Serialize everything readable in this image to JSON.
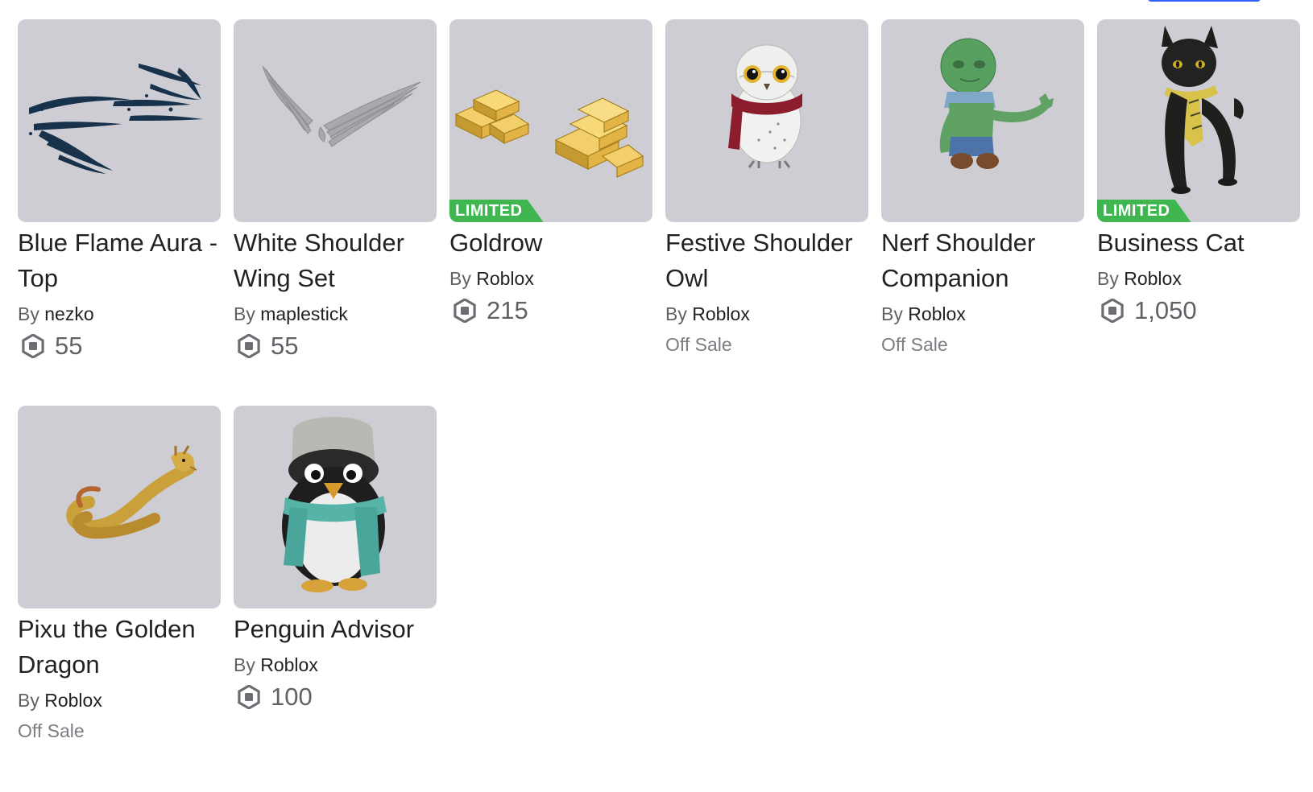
{
  "items": [
    {
      "name": "Blue Flame Aura - Top",
      "by": "By",
      "creator": "nezko",
      "price": "55",
      "limited": false,
      "limited_label": "",
      "off_sale_label": "",
      "icon": "blue-flame-aura-icon"
    },
    {
      "name": "White Shoulder Wing Set",
      "by": "By",
      "creator": "maplestick",
      "price": "55",
      "limited": false,
      "limited_label": "",
      "off_sale_label": "",
      "icon": "white-wings-icon"
    },
    {
      "name": "Goldrow",
      "by": "By",
      "creator": "Roblox",
      "price": "215",
      "limited": true,
      "limited_label": "LIMITED",
      "off_sale_label": "",
      "icon": "gold-bars-icon"
    },
    {
      "name": "Festive Shoulder Owl",
      "by": "By",
      "creator": "Roblox",
      "price": "",
      "limited": false,
      "limited_label": "",
      "off_sale_label": "Off Sale",
      "icon": "owl-icon"
    },
    {
      "name": "Nerf Shoulder Companion",
      "by": "By",
      "creator": "Roblox",
      "price": "",
      "limited": false,
      "limited_label": "",
      "off_sale_label": "Off Sale",
      "icon": "zombie-companion-icon"
    },
    {
      "name": "Business Cat",
      "by": "By",
      "creator": "Roblox",
      "price": "1,050",
      "limited": true,
      "limited_label": "LIMITED",
      "off_sale_label": "",
      "icon": "black-cat-icon"
    },
    {
      "name": "Pixu the Golden Dragon",
      "by": "By",
      "creator": "Roblox",
      "price": "",
      "limited": false,
      "limited_label": "",
      "off_sale_label": "Off Sale",
      "icon": "golden-dragon-icon"
    },
    {
      "name": "Penguin Advisor",
      "by": "By",
      "creator": "Roblox",
      "price": "100",
      "limited": false,
      "limited_label": "",
      "off_sale_label": "",
      "icon": "penguin-icon"
    }
  ],
  "colors": {
    "thumb_bg": "#cdcdd3",
    "limited_badge": "#3fb650",
    "robux_icon": "#6b6e72",
    "accent": "#335fff"
  }
}
